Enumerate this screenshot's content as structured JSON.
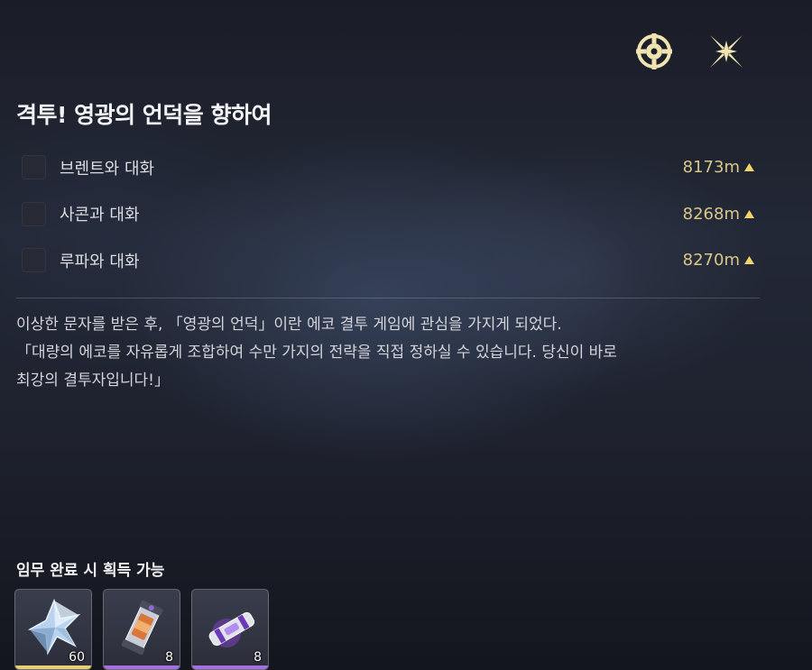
{
  "quest": {
    "title": "격투! 영광의 언덕을 향하여",
    "objectives": [
      {
        "label": "브렌트와 대화",
        "distance": "8173m"
      },
      {
        "label": "사콘과 대화",
        "distance": "8268m"
      },
      {
        "label": "루파와 대화",
        "distance": "8270m"
      }
    ],
    "description": [
      "이상한 문자를 받은 후, 「영광의 언덕」이란 에코 결투 게임에 관심을 가지게 되었다.",
      "「대량의 에코를 자유롭게 조합하여 수만 가지의 전략을 직접 정하실 수 있습니다. 당신이 바로",
      "최강의 결투자입니다!」"
    ]
  },
  "rewards": {
    "title": "임무 완료 시 획득 가능",
    "items": [
      {
        "icon": "crystal-star-icon",
        "quantity": "60",
        "rarity_color": "#e6cf72"
      },
      {
        "icon": "capsule-tube-icon",
        "quantity": "8",
        "rarity_color": "#a56fe0"
      },
      {
        "icon": "purple-cylinder-icon",
        "quantity": "8",
        "rarity_color": "#a56fe0"
      }
    ]
  },
  "colors": {
    "distance": "#d9c68a",
    "icon_gold": "#efe3b0"
  },
  "icons": [
    "track-target-icon",
    "close-x-icon",
    "arrow-up-icon"
  ]
}
